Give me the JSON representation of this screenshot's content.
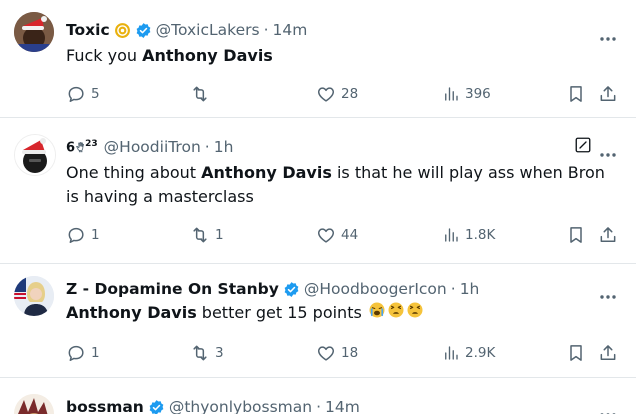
{
  "tweets": [
    {
      "name": "Toxic",
      "handle": "@ToxicLakers",
      "sep": "·",
      "time": "14m",
      "text_plain": "Fuck you ",
      "text_bold": "Anthony Davis",
      "text_rest": "",
      "replies": "5",
      "retweets": "",
      "likes": "28",
      "views": "396"
    },
    {
      "name": "6ₑ₂₃",
      "name_display": "6",
      "name_sup": "23",
      "handle": "@HoodiiTron",
      "sep": "·",
      "time": "1h",
      "text_plain": "One thing about ",
      "text_bold": "Anthony Davis",
      "text_rest": " is that he will play ass when Bron is having a masterclass",
      "replies": "1",
      "retweets": "1",
      "likes": "44",
      "views": "1.8K"
    },
    {
      "name": "Z - Dopamine On Stanby",
      "handle": "@HoodboogerIcon",
      "sep": "·",
      "time": "1h",
      "text_plain": "",
      "text_bold": "Anthony Davis",
      "text_rest": " better get 15 points",
      "replies": "1",
      "retweets": "3",
      "likes": "18",
      "views": "2.9K"
    },
    {
      "name": "bossman",
      "handle": "@thyonlybossman",
      "sep": "·",
      "time": "14m"
    }
  ],
  "colors": {
    "text": "#0f1419",
    "secondary": "#536471",
    "verified": "#1d9bf0",
    "divider": "#e3e7ea",
    "gold_badge": "#e9b10e"
  },
  "icons": [
    "reply-icon",
    "retweet-icon",
    "like-icon",
    "views-icon",
    "bookmark-icon",
    "share-icon",
    "more-icon",
    "verified-icon",
    "edited-icon"
  ]
}
